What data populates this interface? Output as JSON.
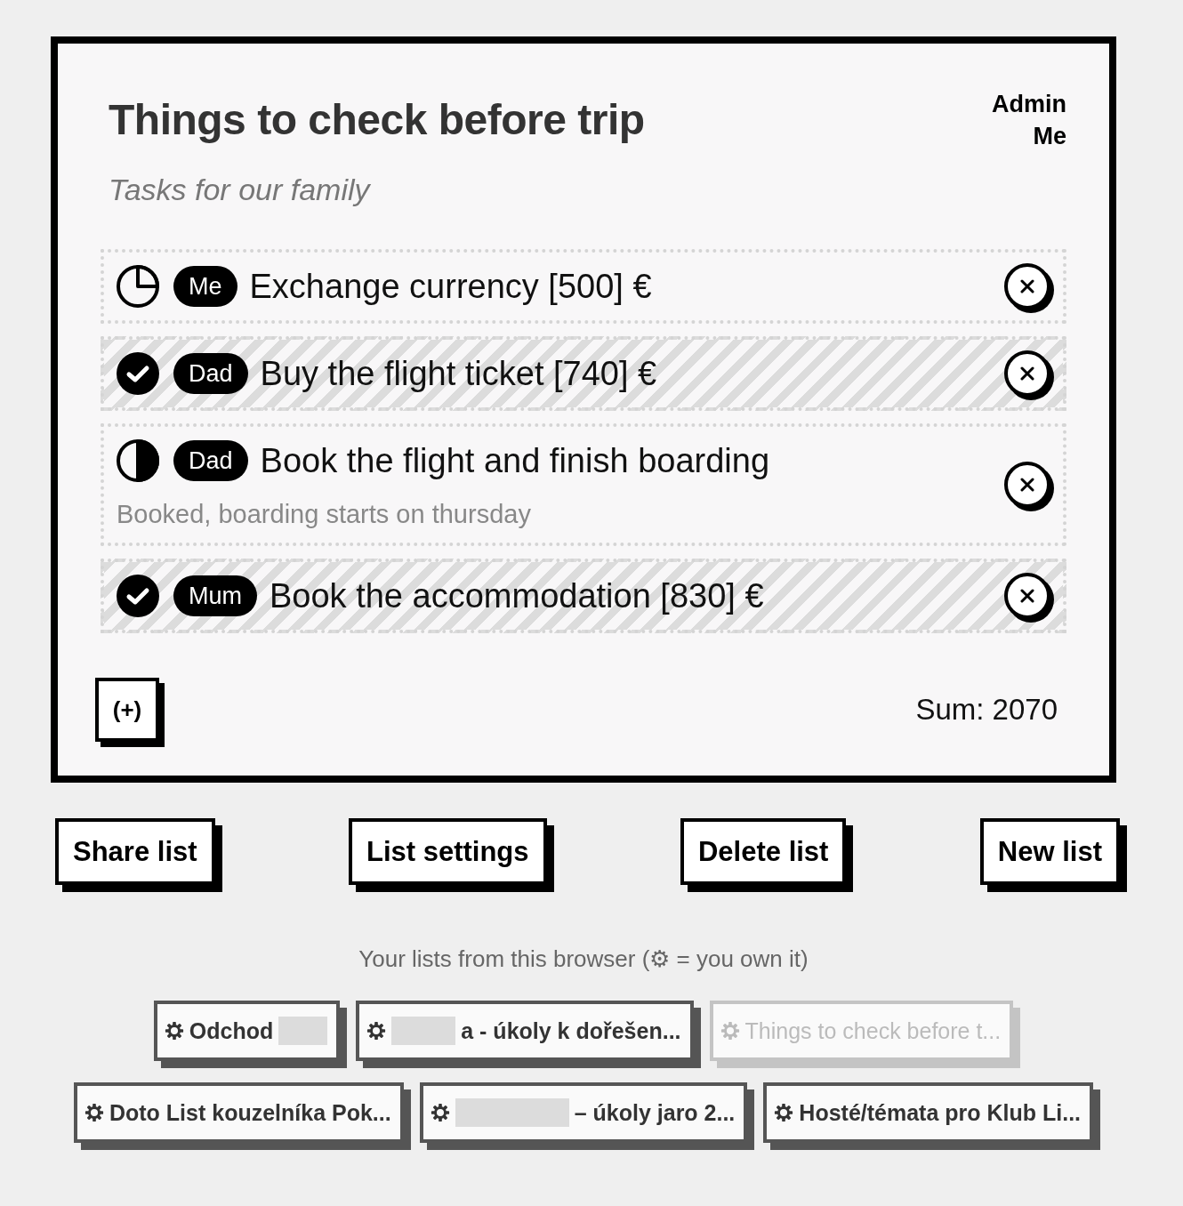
{
  "list": {
    "title": "Things to check before trip",
    "subtitle": "Tasks for our family",
    "admin": {
      "label": "Admin",
      "name": "Me"
    },
    "tasks": [
      {
        "kind": "quarter",
        "assignee": "Me",
        "title": "Exchange currency [500] €"
      },
      {
        "kind": "done",
        "assignee": "Dad",
        "title": "Buy the flight ticket [740] €"
      },
      {
        "kind": "half",
        "assignee": "Dad",
        "title": "Book the flight and finish boarding",
        "note": "Booked, boarding starts on thursday"
      },
      {
        "kind": "done",
        "assignee": "Mum",
        "title": "Book the accommodation [830] €"
      }
    ],
    "add_button": "(+)",
    "sum": "Sum: 2070"
  },
  "actions": [
    "Share list",
    "List settings",
    "Delete list",
    "New list"
  ],
  "saved_lists": {
    "caption": "Your lists from this browser (⚙ = you own it)",
    "items": [
      {
        "label": "Odchod",
        "owned": true,
        "redacted_start": false,
        "redacted_end": true,
        "selected": false
      },
      {
        "label": "a - úkoly k dořešen...",
        "owned": true,
        "redacted_start": true,
        "redacted_end": false,
        "selected": false
      },
      {
        "label": "Things to check before t...",
        "owned": true,
        "redacted_start": false,
        "redacted_end": false,
        "selected": true
      },
      {
        "label": "Doto List kouzelníka Pok...",
        "owned": true,
        "redacted_start": false,
        "redacted_end": false,
        "selected": false
      },
      {
        "label": "– úkoly jaro 2...",
        "owned": true,
        "redacted_start": true,
        "redacted_end": false,
        "selected": false
      },
      {
        "label": "Hosté/témata pro Klub Li...",
        "owned": true,
        "redacted_start": false,
        "redacted_end": false,
        "selected": false
      }
    ]
  }
}
